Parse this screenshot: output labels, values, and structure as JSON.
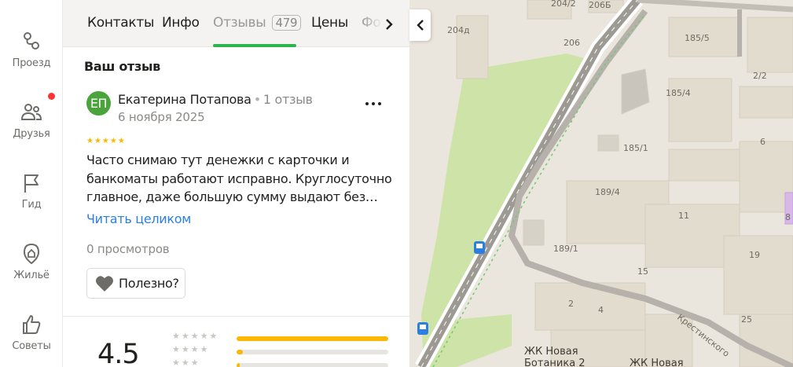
{
  "sidebar": {
    "items": [
      {
        "label": "Проезд",
        "icon": "route-icon"
      },
      {
        "label": "Друзья",
        "icon": "friends-icon"
      },
      {
        "label": "Гид",
        "icon": "flag-icon"
      },
      {
        "label": "Жильё",
        "icon": "home-search-icon"
      },
      {
        "label": "Советы",
        "icon": "thumbs-up-icon"
      }
    ],
    "notification_color": "#ff3333"
  },
  "tabs": {
    "items": [
      "Контакты",
      "Инфо",
      "Отзывы",
      "Цены",
      "Фо"
    ],
    "reviews_count": "479",
    "active": "Отзывы",
    "active_color": "#2db44c"
  },
  "review": {
    "section_title": "Ваш отзыв",
    "avatar_initials": "ЕП",
    "avatar_color": "#4aa33b",
    "author": "Екатерина Потапова",
    "separator": "•",
    "author_reviews": "1 отзыв",
    "date": "6 ноября 2025",
    "stars": "★★★★★",
    "rating": 5,
    "text": "Часто снимаю тут денежки с карточки и банкоматы работают исправно. Круглосуточно главное, даже большую сумму выдают без…",
    "read_more": "Читать целиком",
    "views": "0 просмотров",
    "useful_label": "Полезно?"
  },
  "rating_summary": {
    "value": "4.5",
    "rows": [
      {
        "stars": "★★★★★",
        "fraction": 1.0
      },
      {
        "stars": "★★★★",
        "fraction": 0.04
      },
      {
        "stars": "★★★",
        "fraction": 0.02
      }
    ],
    "bar_color": "#fcb800"
  },
  "map": {
    "labels": [
      "204/2",
      "206Б",
      "204д",
      "206",
      "185/5",
      "2/2",
      "185/4",
      "185/1",
      "6",
      "189/4",
      "11",
      "8",
      "189/1",
      "19",
      "15",
      "2",
      "4",
      "25",
      "Крестинского"
    ],
    "complex_1": [
      "ЖК Новая",
      "Ботаника 2"
    ],
    "complex_2": "ЖК Новая"
  }
}
